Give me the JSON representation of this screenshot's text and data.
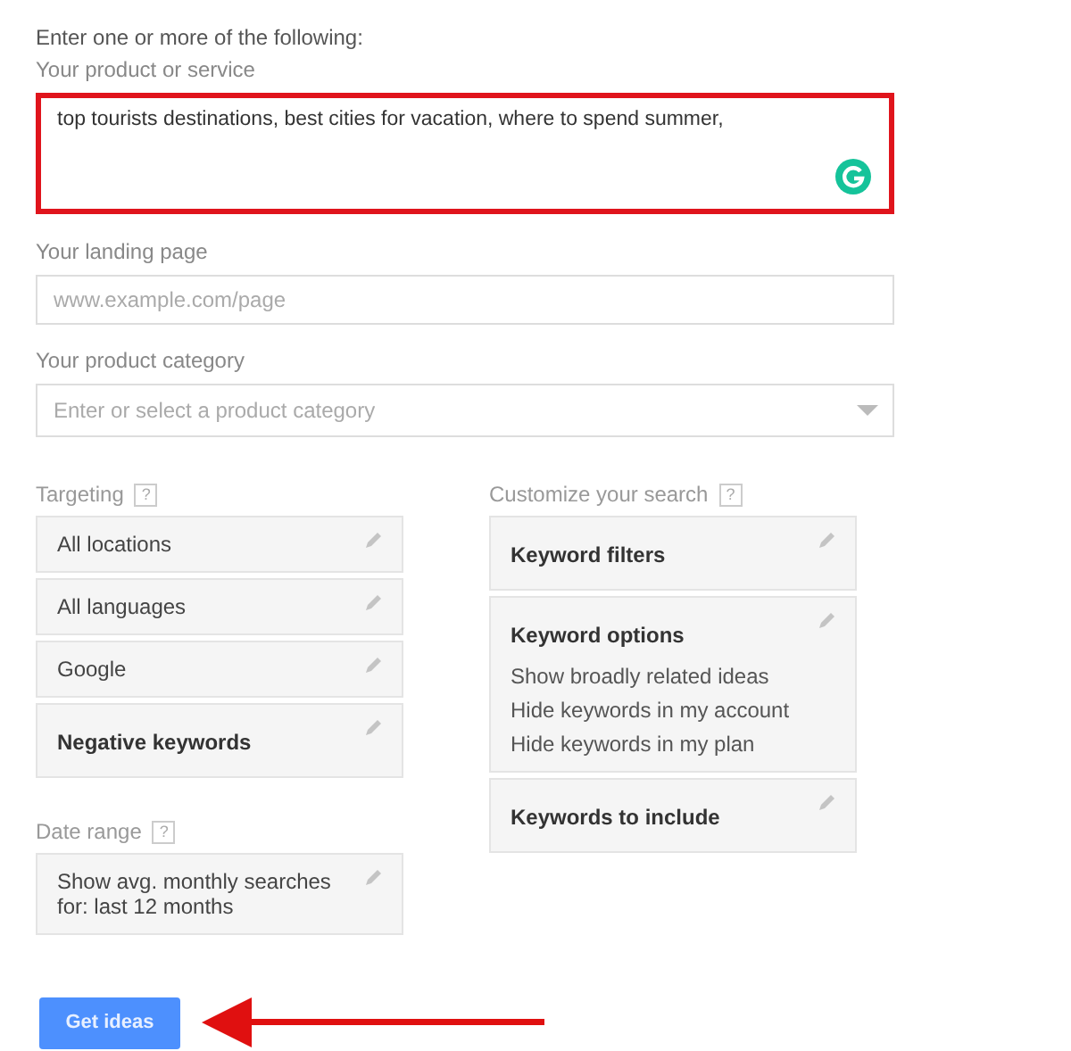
{
  "intro": "Enter one or more of the following:",
  "product": {
    "label": "Your product or service",
    "value": "top tourists destinations, best cities for vacation, where to spend summer,",
    "highlighted": true
  },
  "landing_page": {
    "label": "Your landing page",
    "placeholder": "www.example.com/page"
  },
  "category": {
    "label": "Your product category",
    "placeholder": "Enter or select a product category"
  },
  "targeting": {
    "label": "Targeting",
    "help": "?",
    "cards": [
      {
        "kind": "setting",
        "text": "All locations"
      },
      {
        "kind": "setting",
        "text": "All languages"
      },
      {
        "kind": "setting",
        "text": "Google"
      },
      {
        "kind": "heading",
        "text": "Negative keywords"
      }
    ]
  },
  "date_range": {
    "label": "Date range",
    "help": "?",
    "cards": [
      {
        "kind": "setting",
        "text": "Show avg. monthly searches for: last 12 months"
      }
    ]
  },
  "customize": {
    "label": "Customize your search",
    "help": "?",
    "cards": [
      {
        "kind": "heading",
        "text": "Keyword filters"
      },
      {
        "kind": "heading",
        "text": "Keyword options",
        "options": [
          "Show broadly related ideas",
          "Hide keywords in my account",
          "Hide keywords in my plan"
        ]
      },
      {
        "kind": "heading",
        "text": "Keywords to include"
      }
    ]
  },
  "button": {
    "label": "Get ideas",
    "pointed_at": true
  }
}
